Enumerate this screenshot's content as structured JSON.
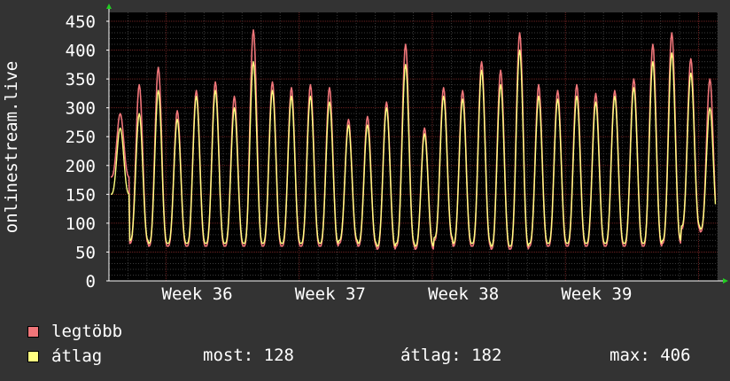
{
  "chart_data": {
    "type": "line",
    "ylabel": "onlinestream.live",
    "ylim": [
      0,
      450
    ],
    "yticks": [
      0,
      50,
      100,
      150,
      200,
      250,
      300,
      350,
      400,
      450
    ],
    "x_labels": [
      "Week 36",
      "Week 37",
      "Week 38",
      "Week 39"
    ],
    "grid": true,
    "days": 32,
    "series": [
      {
        "name": "legtöbb",
        "color": "#f0767a",
        "daily_peaks": [
          290,
          340,
          370,
          295,
          330,
          345,
          320,
          435,
          345,
          335,
          340,
          335,
          280,
          285,
          310,
          410,
          265,
          335,
          330,
          380,
          365,
          430,
          340,
          330,
          340,
          325,
          330,
          350,
          410,
          430,
          385,
          350
        ],
        "daily_troughs": [
          180,
          65,
          60,
          60,
          60,
          60,
          60,
          60,
          60,
          60,
          60,
          60,
          65,
          60,
          55,
          60,
          55,
          70,
          60,
          60,
          55,
          55,
          60,
          60,
          60,
          60,
          60,
          60,
          60,
          65,
          90,
          85
        ]
      },
      {
        "name": "átlag",
        "color": "#ffff80",
        "daily_peaks": [
          265,
          290,
          330,
          280,
          320,
          330,
          300,
          380,
          330,
          320,
          320,
          310,
          270,
          270,
          300,
          375,
          255,
          320,
          315,
          365,
          340,
          400,
          320,
          315,
          320,
          310,
          320,
          335,
          380,
          395,
          360,
          300
        ],
        "daily_troughs": [
          150,
          70,
          65,
          65,
          65,
          65,
          65,
          65,
          65,
          65,
          65,
          65,
          70,
          65,
          60,
          65,
          60,
          75,
          65,
          65,
          60,
          60,
          65,
          65,
          65,
          65,
          65,
          65,
          65,
          70,
          95,
          90
        ]
      }
    ]
  },
  "legend": {
    "max_label": "legtöbb",
    "avg_label": "átlag",
    "max_color": "#f0767a",
    "avg_color": "#ffff80"
  },
  "stats": {
    "now": "most: 128",
    "avg": "átlag: 182",
    "max": "max: 406"
  }
}
